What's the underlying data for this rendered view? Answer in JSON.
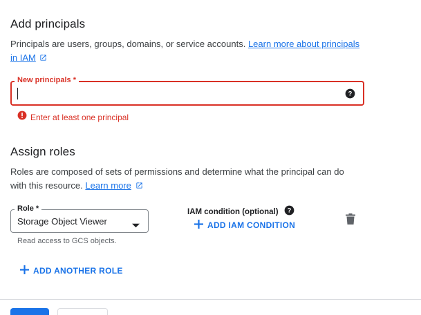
{
  "principals": {
    "title": "Add principals",
    "description": "Principals are users, groups, domains, or service accounts.",
    "learn_link_line1": "Learn more about principals",
    "learn_link_line2": "in IAM",
    "field_label": "New principals *",
    "field_value": "",
    "error": "Enter at least one principal"
  },
  "roles": {
    "title": "Assign roles",
    "description_line1": "Roles are composed of sets of permissions and determine what the principal can do",
    "description_line2": "with this resource.",
    "learn_more": "Learn more",
    "role_label": "Role *",
    "role_value": "Storage Object Viewer",
    "role_hint": "Read access to GCS objects.",
    "condition_label": "IAM condition (optional)",
    "add_condition": "ADD IAM CONDITION",
    "add_another_role": "ADD ANOTHER ROLE"
  },
  "colors": {
    "accent": "#1a73e8",
    "error": "#d93025"
  }
}
